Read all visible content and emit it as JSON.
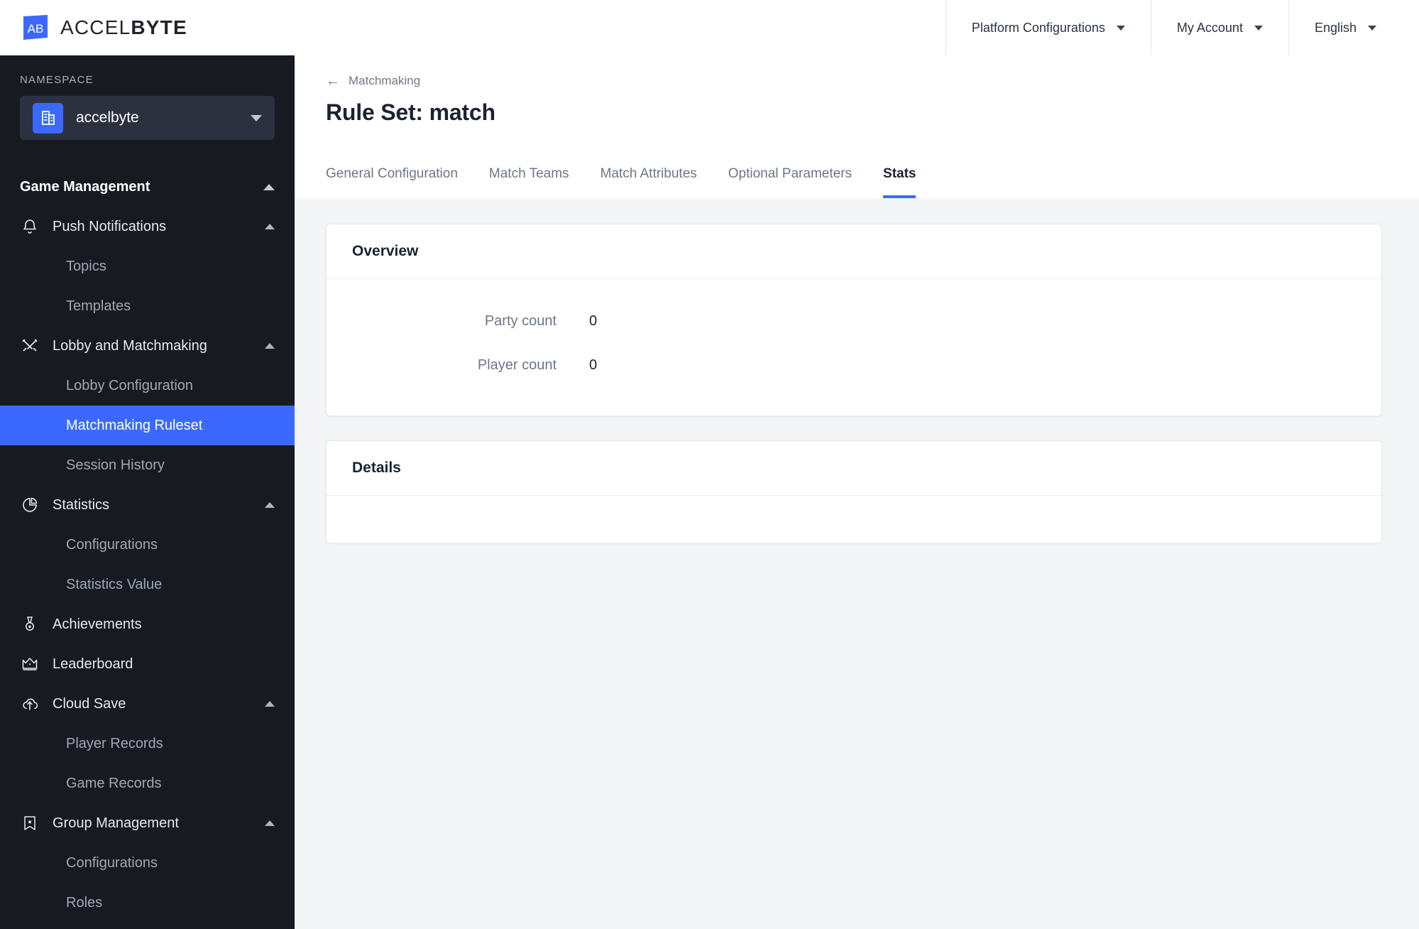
{
  "header": {
    "brand_prefix": "ACCEL",
    "brand_suffix": "BYTE",
    "logo_icon": "accelbyte-ab-logo",
    "nav": [
      {
        "label": "Platform Configurations",
        "icon": "chevron-down-icon"
      },
      {
        "label": "My Account",
        "icon": "chevron-down-icon"
      },
      {
        "label": "English",
        "icon": "chevron-down-icon"
      }
    ]
  },
  "sidebar": {
    "namespace_label": "NAMESPACE",
    "namespace_value": "accelbyte",
    "namespace_icon": "building-icon",
    "namespace_chevron": "chevron-down-icon",
    "section_title": "Game Management",
    "section_caret": "chevron-up-icon",
    "groups": [
      {
        "label": "Push Notifications",
        "icon": "bell-icon",
        "caret": "chevron-up-icon",
        "items": [
          {
            "label": "Topics",
            "active": false
          },
          {
            "label": "Templates",
            "active": false
          }
        ]
      },
      {
        "label": "Lobby and Matchmaking",
        "icon": "crossed-swords-icon",
        "caret": "chevron-up-icon",
        "items": [
          {
            "label": "Lobby Configuration",
            "active": false
          },
          {
            "label": "Matchmaking Ruleset",
            "active": true
          },
          {
            "label": "Session History",
            "active": false
          }
        ]
      },
      {
        "label": "Statistics",
        "icon": "pie-chart-icon",
        "caret": "chevron-up-icon",
        "items": [
          {
            "label": "Configurations",
            "active": false
          },
          {
            "label": "Statistics Value",
            "active": false
          }
        ]
      },
      {
        "label": "Achievements",
        "icon": "medal-icon",
        "caret": null,
        "items": []
      },
      {
        "label": "Leaderboard",
        "icon": "crown-icon",
        "caret": null,
        "items": []
      },
      {
        "label": "Cloud Save",
        "icon": "cloud-upload-icon",
        "caret": "chevron-up-icon",
        "items": [
          {
            "label": "Player Records",
            "active": false
          },
          {
            "label": "Game Records",
            "active": false
          }
        ]
      },
      {
        "label": "Group Management",
        "icon": "banner-star-icon",
        "caret": "chevron-up-icon",
        "items": [
          {
            "label": "Configurations",
            "active": false
          },
          {
            "label": "Roles",
            "active": false
          }
        ]
      }
    ]
  },
  "main": {
    "breadcrumb": {
      "back_icon": "arrow-left-icon",
      "label": "Matchmaking"
    },
    "page_title": "Rule Set: match",
    "tabs": [
      {
        "label": "General Configuration",
        "active": false
      },
      {
        "label": "Match Teams",
        "active": false
      },
      {
        "label": "Match Attributes",
        "active": false
      },
      {
        "label": "Optional Parameters",
        "active": false
      },
      {
        "label": "Stats",
        "active": true
      }
    ],
    "overview_card": {
      "title": "Overview",
      "rows": [
        {
          "label": "Party count",
          "value": "0"
        },
        {
          "label": "Player count",
          "value": "0"
        }
      ]
    },
    "details_card": {
      "title": "Details",
      "rows": []
    }
  },
  "colors": {
    "accent": "#3b69ff",
    "sidebar_bg": "#171a21",
    "page_bg": "#f4f5f7",
    "card_bg": "#ffffff",
    "muted_text": "#6d7687"
  }
}
